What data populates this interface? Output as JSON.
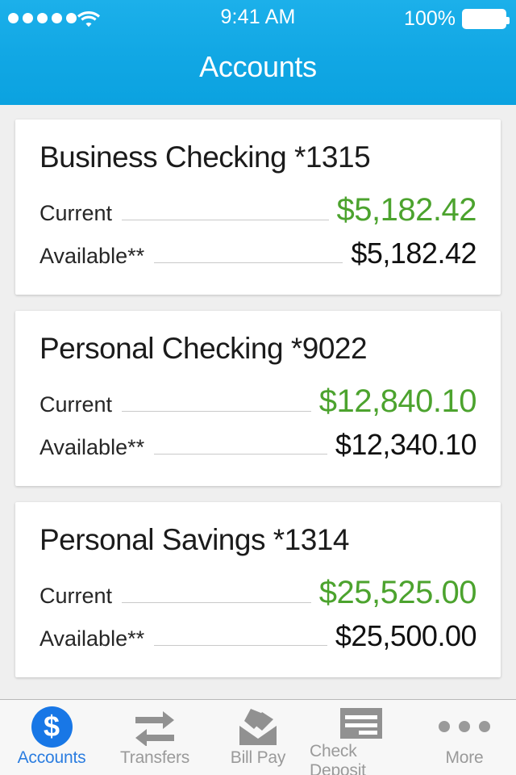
{
  "status_bar": {
    "signal_dots": 5,
    "wifi_icon": "wifi-icon",
    "time": "9:41 AM",
    "battery_percent": "100%",
    "battery_icon": "battery-full-icon"
  },
  "header": {
    "title": "Accounts",
    "background_color": "#11a7e4"
  },
  "colors": {
    "accent_blue": "#11a7e4",
    "tab_active_blue": "#2b7de0",
    "positive_green": "#4ca32e",
    "value_black": "#111111",
    "page_background": "#efefef",
    "card_background": "#ffffff",
    "tab_inactive_gray": "#9a9a9a"
  },
  "accounts": [
    {
      "name": "Business Checking *1315",
      "current_label": "Current",
      "current_value": "$5,182.42",
      "available_label": "Available**",
      "available_value": "$5,182.42"
    },
    {
      "name": "Personal Checking *9022",
      "current_label": "Current",
      "current_value": "$12,840.10",
      "available_label": "Available**",
      "available_value": "$12,340.10"
    },
    {
      "name": "Personal Savings *1314",
      "current_label": "Current",
      "current_value": "$25,525.00",
      "available_label": "Available**",
      "available_value": "$25,500.00"
    }
  ],
  "tab_bar": {
    "items": [
      {
        "label": "Accounts",
        "icon": "dollar-circle-icon",
        "active": true
      },
      {
        "label": "Transfers",
        "icon": "transfer-arrows-icon",
        "active": false
      },
      {
        "label": "Bill Pay",
        "icon": "envelope-check-icon",
        "active": false
      },
      {
        "label": "Check Deposit",
        "icon": "check-document-icon",
        "active": false
      },
      {
        "label": "More",
        "icon": "ellipsis-icon",
        "active": false
      }
    ]
  }
}
